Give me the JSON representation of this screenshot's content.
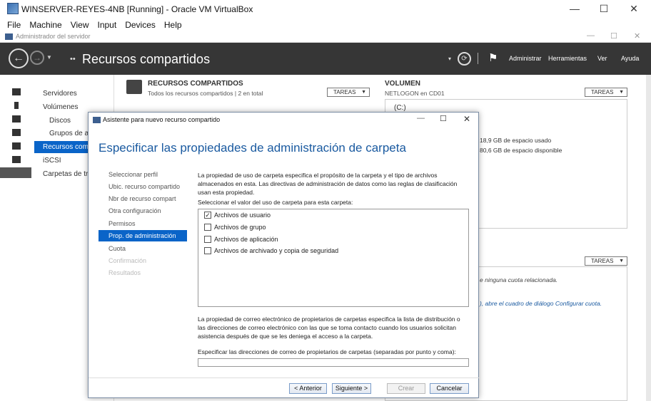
{
  "vbox": {
    "title": "WINSERVER-REYES-4NB [Running] - Oracle VM VirtualBox",
    "menu": [
      "File",
      "Machine",
      "View",
      "Input",
      "Devices",
      "Help"
    ],
    "min": "—",
    "max": "☐",
    "close": "✕"
  },
  "sm": {
    "window_title": "Administrador del servidor",
    "header_title": "Recursos compartidos",
    "header_dots": "••",
    "menu": {
      "administrar": "Administrar",
      "herramientas": "Herramientas",
      "ver": "Ver",
      "ayuda": "Ayuda"
    }
  },
  "sidebar": {
    "items": [
      "Servidores",
      "Volúmenes",
      "Discos",
      "Grupos de a",
      "Recursos com",
      "iSCSI",
      "Carpetas de tr"
    ]
  },
  "bg": {
    "shares_title": "RECURSOS COMPARTIDOS",
    "shares_sub": "Todos los recursos compartidos | 2 en total",
    "tareas": "TAREAS",
    "vol_title": "VOLUMEN",
    "vol_sub": "NETLOGON en CD01",
    "vol_drive": "(C:)",
    "used": "18,9 GB de espacio usado",
    "free": "80,6 GB de espacio disponible",
    "quota_none": "e ninguna cuota relacionada.",
    "quota_link": "), abre el cuadro de diálogo Configurar cuota."
  },
  "dialog": {
    "title": "Asistente para nuevo recurso compartido",
    "heading": "Especificar las propiedades de administración de carpeta",
    "steps": [
      "Seleccionar perfil",
      "Ubic. recurso compartido",
      "Nbr de recurso compart",
      "Otra configuración",
      "Permisos",
      "Prop. de administración",
      "Cuota",
      "Confirmación",
      "Resultados"
    ],
    "intro": "La propiedad de uso de carpeta especifica el propósito de la carpeta y el tipo de archivos almacenados en esta. Las directivas de administración de datos como las reglas de clasificación usan esta propiedad.",
    "select_label": "Seleccionar el valor del uso de carpeta para esta carpeta:",
    "options": [
      {
        "label": "Archivos de usuario",
        "checked": true
      },
      {
        "label": "Archivos de grupo",
        "checked": false
      },
      {
        "label": "Archivos de aplicación",
        "checked": false
      },
      {
        "label": "Archivos de archivado y copia de seguridad",
        "checked": false
      }
    ],
    "email_desc": "La propiedad de correo electrónico de propietarios de carpetas especifica la lista de distribución o las direcciones de correo electrónico con las que se toma contacto cuando los usuarios solicitan asistencia después de que se les deniega el acceso a la carpeta.",
    "email_label": "Especificar las direcciones de correo de propietarios de carpetas (separadas por punto y coma):",
    "buttons": {
      "back": "< Anterior",
      "next": "Siguiente >",
      "create": "Crear",
      "cancel": "Cancelar"
    }
  }
}
